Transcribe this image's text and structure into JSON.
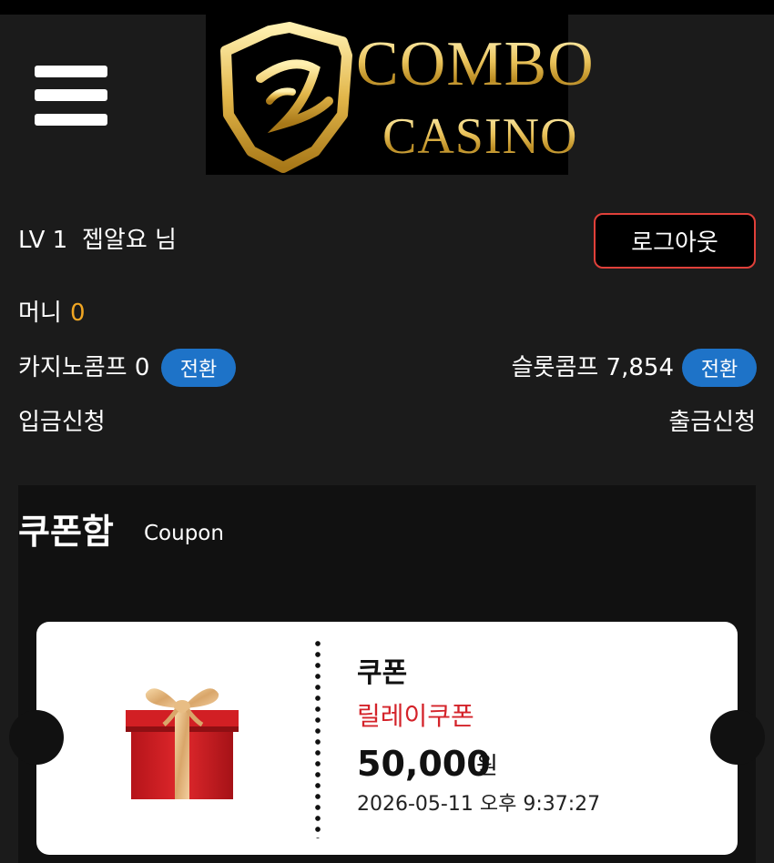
{
  "logo": {
    "line1": "COMBO",
    "line2": "CASINO",
    "colors": {
      "gold": "#e9c25a",
      "background": "#000000"
    }
  },
  "header": {
    "menu_icon": "hamburger-menu-icon"
  },
  "user": {
    "level": "LV 1",
    "nickname": "젭알요 님",
    "logout_label": "로그아웃"
  },
  "wallet": {
    "money_label": "머니",
    "money_value": "0",
    "casino_comp_label": "카지노콤프 0",
    "slot_comp_label": "슬롯콤프 7,854",
    "convert_label": "전환",
    "deposit_label": "입금신청",
    "withdraw_label": "출금신청"
  },
  "coupons": {
    "title": "쿠폰함",
    "subtitle": "Coupon",
    "items": [
      {
        "icon": "gift-box-icon",
        "title": "쿠폰",
        "name": "릴레이쿠폰",
        "amount": "50,000",
        "currency": "원",
        "date": "2026-05-11 오후 9:37:27"
      }
    ]
  },
  "colors": {
    "background": "#1b1b1b",
    "accent_orange": "#f0a623",
    "button_blue": "#1e73c8",
    "logout_border": "#e0403a",
    "coupon_red": "#d4232a"
  }
}
